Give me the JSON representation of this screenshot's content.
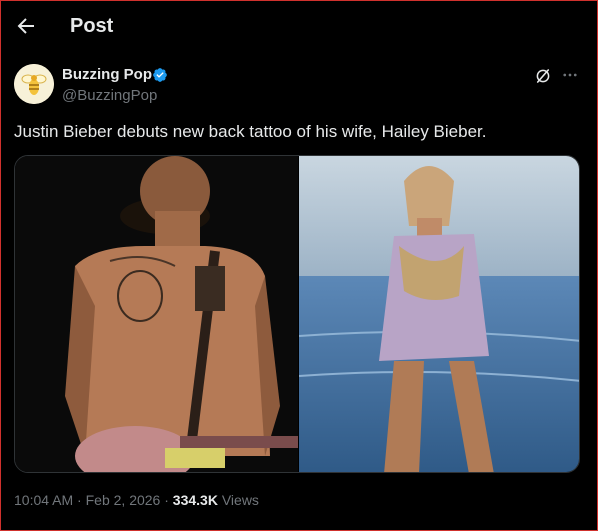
{
  "header": {
    "title": "Post"
  },
  "post": {
    "author": {
      "name": "Buzzing Pop",
      "handle": "@BuzzingPop"
    },
    "text": "Justin Bieber debuts new back tattoo of his wife, Hailey Bieber.",
    "meta": {
      "time": "10:04 AM",
      "separator": "·",
      "date": "Feb 2, 2026",
      "views": "334.3K",
      "views_label": "Views"
    }
  },
  "colors": {
    "background": "#000000",
    "text_primary": "#e7e9ea",
    "text_secondary": "#71767b",
    "verified": "#1d9bf0",
    "border": "#2f3336"
  },
  "icons": {
    "back": "arrow-left-icon",
    "verified": "verified-badge-icon",
    "grok": "grok-icon",
    "more": "more-icon"
  }
}
